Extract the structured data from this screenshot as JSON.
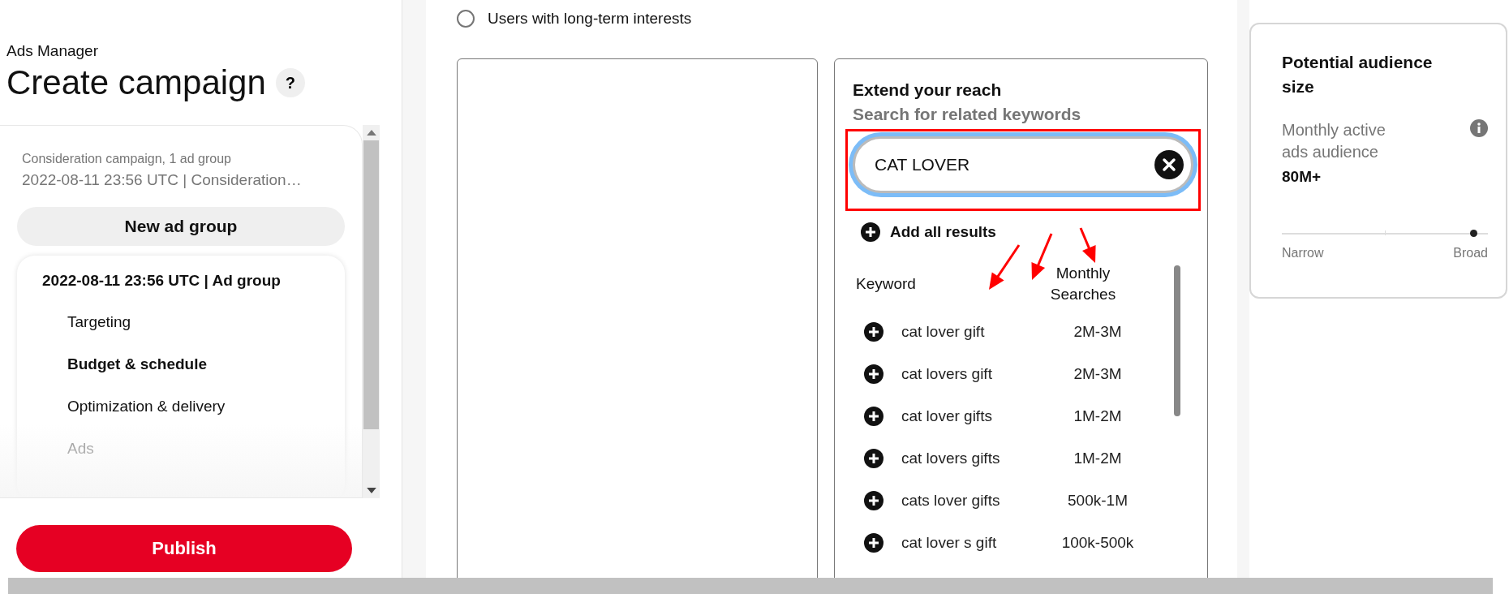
{
  "header": {
    "breadcrumb": "Ads Manager",
    "title": "Create campaign",
    "help_icon": "?"
  },
  "campaign": {
    "summary": "Consideration campaign, 1 ad group",
    "name": "2022-08-11 23:56 UTC | Consideration…"
  },
  "new_ad_group_button": "New ad group",
  "ad_group": {
    "title": "2022-08-11 23:56 UTC | Ad group",
    "steps": [
      {
        "label": "Targeting",
        "selected": false,
        "disabled": false
      },
      {
        "label": "Budget & schedule",
        "selected": true,
        "disabled": false
      },
      {
        "label": "Optimization & delivery",
        "selected": false,
        "disabled": false
      },
      {
        "label": "Ads",
        "selected": false,
        "disabled": true
      }
    ]
  },
  "publish_button": "Publish",
  "targeting_option": {
    "label": "Users with long-term interests",
    "selected": false
  },
  "keywords": {
    "title": "Extend your reach",
    "subtitle": "Search for related keywords",
    "search": {
      "value": "CAT LOVER",
      "focused": true
    },
    "add_all": "Add all results",
    "columns": [
      "Keyword",
      "Monthly Searches"
    ],
    "rows": [
      {
        "keyword": "cat lover gift",
        "searches": "2M-3M"
      },
      {
        "keyword": "cat lovers gift",
        "searches": "2M-3M"
      },
      {
        "keyword": "cat lover gifts",
        "searches": "1M-2M"
      },
      {
        "keyword": "cat lovers gifts",
        "searches": "1M-2M"
      },
      {
        "keyword": "cats lover gifts",
        "searches": "500k-1M"
      },
      {
        "keyword": "cat lover s gift",
        "searches": "100k-500k"
      }
    ]
  },
  "audience": {
    "title": "Potential audience size",
    "metric_label": "Monthly active ads audience",
    "metric_value": "80M+",
    "slider": {
      "level": 0.93,
      "min_label": "Narrow",
      "max_label": "Broad"
    }
  }
}
